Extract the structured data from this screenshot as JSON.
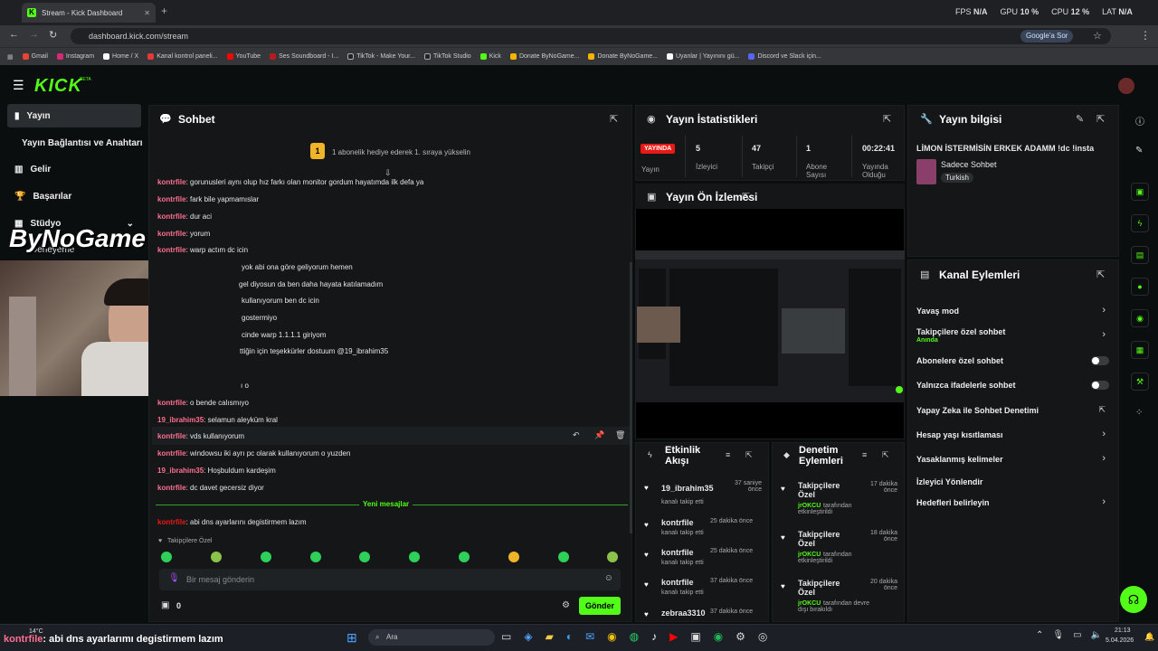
{
  "browser": {
    "tab_title": "Stream - Kick Dashboard",
    "url": "dashboard.kick.com/stream",
    "google_btn": "Google'a Sor",
    "stats": {
      "fps_label": "FPS",
      "fps": "N/A",
      "gpu_label": "GPU",
      "gpu": "10 %",
      "cpu_label": "CPU",
      "cpu": "12 %",
      "lat_label": "LAT",
      "lat": "N/A"
    },
    "bookmarks": [
      "Gmail",
      "Instagram",
      "Home / X",
      "Kanal kontrol paneli...",
      "YouTube",
      "Ses Soundboard - I...",
      "TikTok - Make Your...",
      "TikTok Studio",
      "Kick",
      "Donate ByNoGame...",
      "Donate ByNoGame...",
      "Uyanlar | Yayınını gü...",
      "Discord ve Slack için..."
    ]
  },
  "app": {
    "logo": "KICK",
    "beta": "BETA"
  },
  "sidebar": {
    "items": [
      "Yayın",
      "Yayın Bağlantısı ve Anahtarı",
      "Gelir",
      "Başarılar",
      "Stüdyo",
      "Deneyeme"
    ]
  },
  "overlay": {
    "brand": "ByNoGame"
  },
  "chat": {
    "title": "Sohbet",
    "banner": "1 abonelik hediye ederek 1. sıraya yükselin",
    "badge": "1",
    "messages": [
      {
        "user": "kontrfile",
        "text": "gorunusleri aynı olup hız farkı olan monitor gordum hayatımda ilk defa ya"
      },
      {
        "user": "kontrfile",
        "text": "fark bile yapmamıslar"
      },
      {
        "user": "kontrfile",
        "text": "dur aci"
      },
      {
        "user": "kontrfile",
        "text": "yorum"
      },
      {
        "user": "kontrfile",
        "text": "warp actım dc icin"
      },
      {
        "user": "",
        "text": "yok abi ona göre geliyorum hemen"
      },
      {
        "user": "",
        "text": "gel diyosun da ben daha hayata katılamadım"
      },
      {
        "user": "",
        "text": "kullanıyorum ben dc icin"
      },
      {
        "user": "",
        "text": "gostermiyo"
      },
      {
        "user": "",
        "text": "cinde warp 1.1.1.1 giriyom"
      },
      {
        "user": "",
        "text": "ttiğin için teşekkürler dostuum @19_ibrahim35"
      },
      {
        "user": "",
        "text": "ı o"
      },
      {
        "user": "kontrfile",
        "text": "o bende calısmıyo"
      },
      {
        "user": "19_ibrahim35",
        "text": "selamun aleyküm kral"
      },
      {
        "user": "kontrfile",
        "text": "vds kullanıyorum"
      },
      {
        "user": "kontrfile",
        "text": "windowsu iki ayrı pc olarak kullanıyorum o yuzden"
      },
      {
        "user": "19_ibrahim35",
        "text": "Hoşbuldum kardeşim"
      },
      {
        "user": "kontrfile",
        "text": "dc davet gecersiz diyor"
      }
    ],
    "new_messages": "Yeni mesajlar",
    "last": {
      "user": "kontrfile",
      "text": "abi dns ayarlarını degistirmem lazım"
    },
    "followers_only": "Takipçilere Özel",
    "input_placeholder": "Bir mesaj gönderin",
    "points": "0",
    "send": "Gönder"
  },
  "stats": {
    "title": "Yayın İstatistikleri",
    "live": "YAYINDA",
    "live_label": "Yayın",
    "cols": [
      {
        "value": "5",
        "label": "İzleyici"
      },
      {
        "value": "47",
        "label": "Takipçi"
      },
      {
        "value": "1",
        "label": "Abone Sayısı"
      },
      {
        "value": "00:22:41",
        "label": "Yayında Olduğu"
      }
    ]
  },
  "preview": {
    "title": "Yayın Ön İzlemesi"
  },
  "info": {
    "title": "Yayın bilgisi",
    "stream_title": "LİMON İSTERMİSİN ERKEK ADAMM !dc !insta",
    "category": "Sadece Sohbet",
    "language": "Turkish"
  },
  "actions": {
    "title": "Kanal Eylemleri",
    "items": [
      {
        "label": "Yavaş mod",
        "sub": "",
        "type": "chevron"
      },
      {
        "label": "Takipçilere özel sohbet",
        "sub": "Anında",
        "type": "chevron"
      },
      {
        "label": "Abonelere özel sohbet",
        "sub": "",
        "type": "toggle"
      },
      {
        "label": "Yalnızca ifadelerle sohbet",
        "sub": "",
        "type": "toggle"
      },
      {
        "label": "Yapay Zeka ile Sohbet Denetimi",
        "sub": "",
        "type": "external"
      },
      {
        "label": "Hesap yaşı kısıtlaması",
        "sub": "",
        "type": "chevron"
      },
      {
        "label": "Yasaklanmış kelimeler",
        "sub": "",
        "type": "chevron"
      },
      {
        "label": "İzleyici Yönlendir",
        "sub": "",
        "type": "none"
      },
      {
        "label": "Hedefleri belirleyin",
        "sub": "",
        "type": "chevron"
      }
    ]
  },
  "activity": {
    "title": "Etkinlik Akışı",
    "items": [
      {
        "user": "19_ibrahim35",
        "time": "37 saniye önce",
        "desc": "kanalı takip etti"
      },
      {
        "user": "kontrfile",
        "time": "25 dakika önce",
        "desc": "kanalı takip etti"
      },
      {
        "user": "kontrfile",
        "time": "25 dakika önce",
        "desc": "kanalı takip etti"
      },
      {
        "user": "kontrfile",
        "time": "37 dakika önce",
        "desc": "kanalı takip etti"
      },
      {
        "user": "zebraa3310",
        "time": "37 dakika önce",
        "desc": ""
      }
    ]
  },
  "moderation": {
    "title": "Denetim Eylemleri",
    "items": [
      {
        "label": "Takipçilere Özel",
        "time": "17 dakika önce",
        "mod": "jrOKCU",
        "desc": "tarafından etkinleştirildi"
      },
      {
        "label": "Takipçilere Özel",
        "time": "18 dakika önce",
        "mod": "jrOKCU",
        "desc": "tarafından etkinleştirildi"
      },
      {
        "label": "Takipçilere Özel",
        "time": "20 dakika önce",
        "mod": "jrOKCU",
        "desc": "tarafından devre dışı bırakıldı"
      }
    ]
  },
  "taskbar": {
    "weather": "14°C",
    "caption_user": "kontrfile",
    "caption_text": ": abi dns ayarlarımı degistirmem lazım",
    "search": "Ara",
    "time": "21:13",
    "date": "5.04.2026"
  },
  "colors": {
    "accent": "#53fc18",
    "live": "#e91916",
    "username": "#ff6f8f",
    "mod": "#53fc18"
  }
}
